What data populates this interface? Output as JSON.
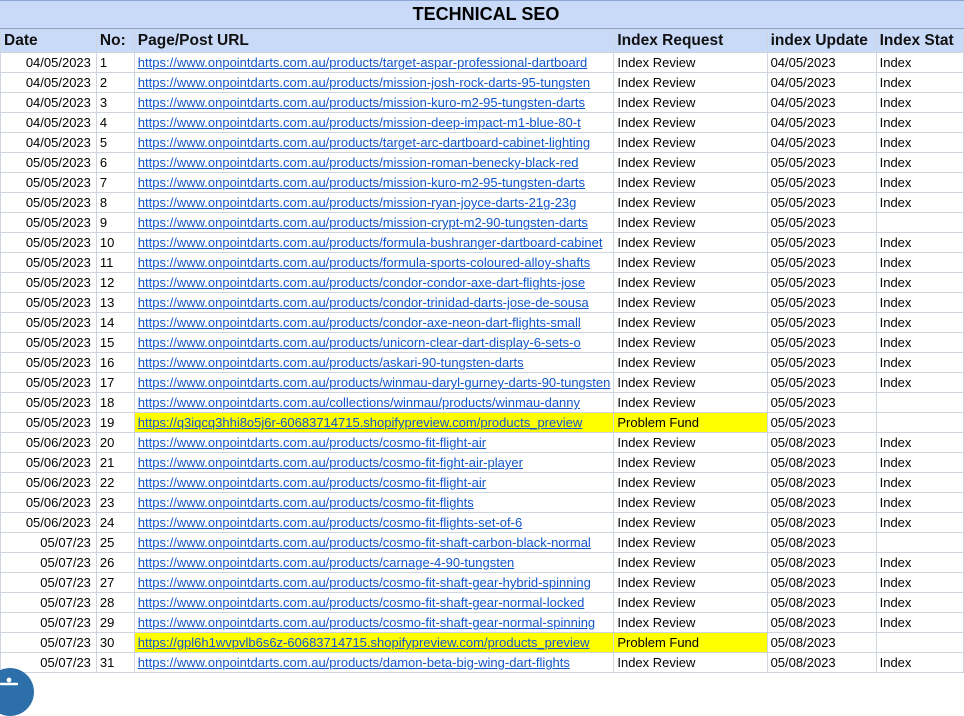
{
  "sheet": {
    "title": "TECHNICAL SEO"
  },
  "headers": [
    "Date",
    "No:",
    "Page/Post URL",
    "Index Request",
    "index Update",
    "Index Stat"
  ],
  "rows": [
    {
      "date": "04/05/2023",
      "no": "1",
      "url": "https://www.onpointdarts.com.au/products/target-aspar-professional-dartboard",
      "req": "Index Review",
      "upd": "04/05/2023",
      "stat": "Index"
    },
    {
      "date": "04/05/2023",
      "no": "2",
      "url": "https://www.onpointdarts.com.au/products/mission-josh-rock-darts-95-tungsten",
      "req": "Index Review",
      "upd": "04/05/2023",
      "stat": "Index"
    },
    {
      "date": "04/05/2023",
      "no": "3",
      "url": "https://www.onpointdarts.com.au/products/mission-kuro-m2-95-tungsten-darts",
      "req": "Index Review",
      "upd": "04/05/2023",
      "stat": "Index"
    },
    {
      "date": "04/05/2023",
      "no": "4",
      "url": "https://www.onpointdarts.com.au/products/mission-deep-impact-m1-blue-80-t",
      "req": "Index Review",
      "upd": "04/05/2023",
      "stat": "Index"
    },
    {
      "date": "04/05/2023",
      "no": "5",
      "url": "https://www.onpointdarts.com.au/products/target-arc-dartboard-cabinet-lighting",
      "req": "Index Review",
      "upd": "04/05/2023",
      "stat": "Index"
    },
    {
      "date": "05/05/2023",
      "no": "6",
      "url": "https://www.onpointdarts.com.au/products/mission-roman-benecky-black-red",
      "req": "Index Review",
      "upd": "05/05/2023",
      "stat": "Index"
    },
    {
      "date": "05/05/2023",
      "no": "7",
      "url": "https://www.onpointdarts.com.au/products/mission-kuro-m2-95-tungsten-darts",
      "req": "Index Review",
      "upd": "05/05/2023",
      "stat": "Index"
    },
    {
      "date": "05/05/2023",
      "no": "8",
      "url": "https://www.onpointdarts.com.au/products/mission-ryan-joyce-darts-21g-23g",
      "req": "Index Review",
      "upd": "05/05/2023",
      "stat": "Index"
    },
    {
      "date": "05/05/2023",
      "no": "9",
      "url": "https://www.onpointdarts.com.au/products/mission-crypt-m2-90-tungsten-darts",
      "req": "Index Review",
      "upd": "05/05/2023",
      "stat": ""
    },
    {
      "date": "05/05/2023",
      "no": "10",
      "url": "https://www.onpointdarts.com.au/products/formula-bushranger-dartboard-cabinet",
      "req": "Index Review",
      "upd": "05/05/2023",
      "stat": "Index"
    },
    {
      "date": "05/05/2023",
      "no": "11",
      "url": "https://www.onpointdarts.com.au/products/formula-sports-coloured-alloy-shafts",
      "req": "Index Review",
      "upd": "05/05/2023",
      "stat": "Index"
    },
    {
      "date": "05/05/2023",
      "no": "12",
      "url": "https://www.onpointdarts.com.au/products/condor-condor-axe-dart-flights-jose",
      "req": "Index Review",
      "upd": "05/05/2023",
      "stat": "Index"
    },
    {
      "date": "05/05/2023",
      "no": "13",
      "url": "https://www.onpointdarts.com.au/products/condor-trinidad-darts-jose-de-sousa",
      "req": "Index Review",
      "upd": "05/05/2023",
      "stat": "Index"
    },
    {
      "date": "05/05/2023",
      "no": "14",
      "url": "https://www.onpointdarts.com.au/products/condor-axe-neon-dart-flights-small",
      "req": "Index Review",
      "upd": "05/05/2023",
      "stat": "Index"
    },
    {
      "date": "05/05/2023",
      "no": "15",
      "url": "https://www.onpointdarts.com.au/products/unicorn-clear-dart-display-6-sets-o",
      "req": "Index Review",
      "upd": "05/05/2023",
      "stat": "Index"
    },
    {
      "date": "05/05/2023",
      "no": "16",
      "url": "https://www.onpointdarts.com.au/products/askari-90-tungsten-darts",
      "req": "Index Review",
      "upd": "05/05/2023",
      "stat": "Index"
    },
    {
      "date": "05/05/2023",
      "no": "17",
      "url": "https://www.onpointdarts.com.au/products/winmau-daryl-gurney-darts-90-tungsten",
      "req": "Index Review",
      "upd": "05/05/2023",
      "stat": "Index"
    },
    {
      "date": "05/05/2023",
      "no": "18",
      "url": "https://www.onpointdarts.com.au/collections/winmau/products/winmau-danny",
      "req": "Index Review",
      "upd": "05/05/2023",
      "stat": ""
    },
    {
      "date": "05/05/2023",
      "no": "19",
      "url": "https://q3iqcq3hhi8o5j6r-60683714715.shopifypreview.com/products_preview",
      "req": "Problem Fund",
      "upd": "05/05/2023",
      "stat": "",
      "hl": true
    },
    {
      "date": "05/06/2023",
      "no": "20",
      "url": "https://www.onpointdarts.com.au/products/cosmo-fit-flight-air",
      "req": "Index Review",
      "upd": "05/08/2023",
      "stat": "Index"
    },
    {
      "date": "05/06/2023",
      "no": "21",
      "url": "https://www.onpointdarts.com.au/products/cosmo-fit-fight-air-player",
      "req": "Index Review",
      "upd": "05/08/2023",
      "stat": "Index"
    },
    {
      "date": "05/06/2023",
      "no": "22",
      "url": "https://www.onpointdarts.com.au/products/cosmo-fit-flight-air",
      "req": "Index Review",
      "upd": "05/08/2023",
      "stat": "Index"
    },
    {
      "date": "05/06/2023",
      "no": "23",
      "url": "https://www.onpointdarts.com.au/products/cosmo-fit-flights",
      "req": "Index Review",
      "upd": "05/08/2023",
      "stat": "Index"
    },
    {
      "date": "05/06/2023",
      "no": "24",
      "url": "https://www.onpointdarts.com.au/products/cosmo-fit-flights-set-of-6",
      "req": "Index Review",
      "upd": "05/08/2023",
      "stat": "Index"
    },
    {
      "date": "05/07/23",
      "no": "25",
      "url": "https://www.onpointdarts.com.au/products/cosmo-fit-shaft-carbon-black-normal",
      "req": "Index Review",
      "upd": "05/08/2023",
      "stat": ""
    },
    {
      "date": "05/07/23",
      "no": "26",
      "url": "https://www.onpointdarts.com.au/products/carnage-4-90-tungsten",
      "req": "Index Review",
      "upd": "05/08/2023",
      "stat": "Index"
    },
    {
      "date": "05/07/23",
      "no": "27",
      "url": "https://www.onpointdarts.com.au/products/cosmo-fit-shaft-gear-hybrid-spinning",
      "req": "Index Review",
      "upd": "05/08/2023",
      "stat": "Index"
    },
    {
      "date": "05/07/23",
      "no": "28",
      "url": "https://www.onpointdarts.com.au/products/cosmo-fit-shaft-gear-normal-locked",
      "req": "Index Review",
      "upd": "05/08/2023",
      "stat": "Index"
    },
    {
      "date": "05/07/23",
      "no": "29",
      "url": "https://www.onpointdarts.com.au/products/cosmo-fit-shaft-gear-normal-spinning",
      "req": "Index Review",
      "upd": "05/08/2023",
      "stat": "Index"
    },
    {
      "date": "05/07/23",
      "no": "30",
      "url": "https://gpl6h1wvpvlb6s6z-60683714715.shopifypreview.com/products_preview",
      "req": "Problem Fund",
      "upd": "05/08/2023",
      "stat": "",
      "hl": true
    },
    {
      "date": "05/07/23",
      "no": "31",
      "url": "https://www.onpointdarts.com.au/products/damon-beta-big-wing-dart-flights",
      "req": "Index Review",
      "upd": "05/08/2023",
      "stat": "Index"
    }
  ],
  "help_button": {
    "icon": "accessibility-icon",
    "color": "#2d6fa8"
  }
}
